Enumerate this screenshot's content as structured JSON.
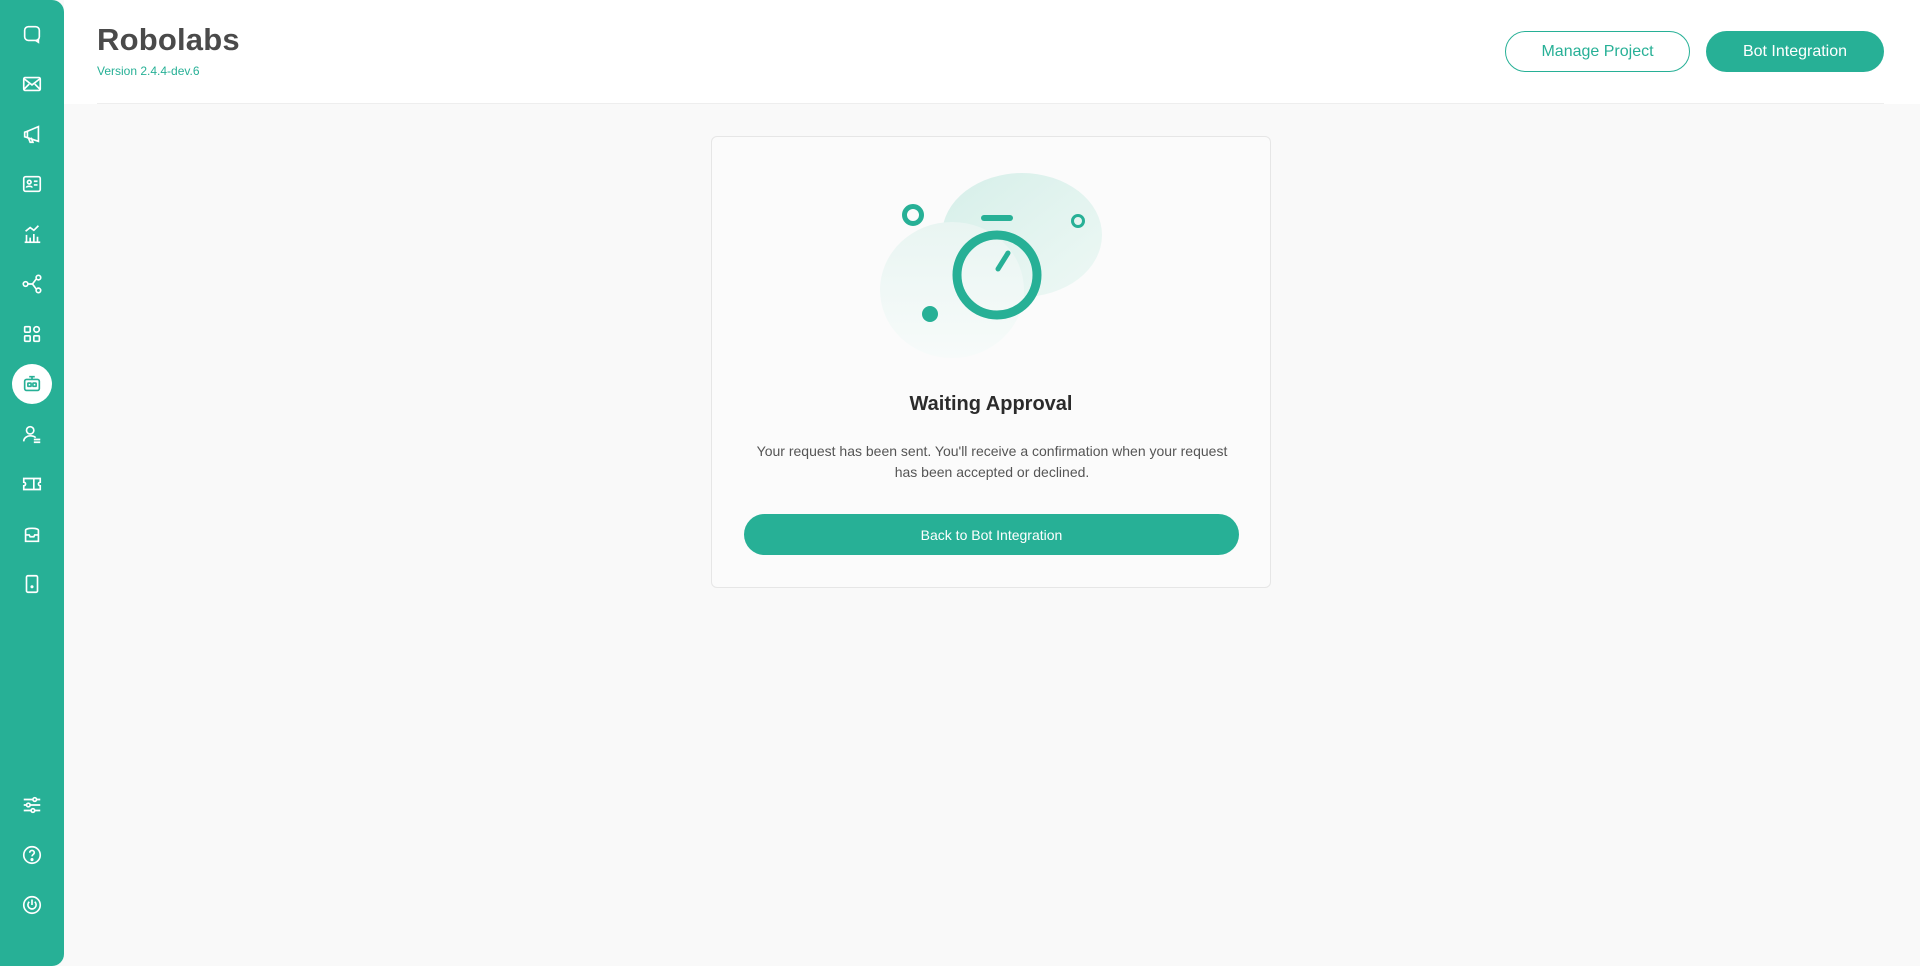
{
  "app": {
    "title": "Robolabs",
    "version": "Version 2.4.4-dev.6"
  },
  "header": {
    "manage_project_label": "Manage Project",
    "bot_integration_label": "Bot Integration"
  },
  "sidebar": {
    "top_items": [
      {
        "icon": "chat-icon",
        "active": false
      },
      {
        "icon": "mail-icon",
        "active": false
      },
      {
        "icon": "megaphone-icon",
        "active": false
      },
      {
        "icon": "contact-card-icon",
        "active": false
      },
      {
        "icon": "analytics-icon",
        "active": false
      },
      {
        "icon": "flow-icon",
        "active": false
      },
      {
        "icon": "apps-grid-icon",
        "active": false
      },
      {
        "icon": "bot-icon",
        "active": true
      },
      {
        "icon": "agent-icon",
        "active": false
      },
      {
        "icon": "ticket-icon",
        "active": false
      },
      {
        "icon": "inbox-icon",
        "active": false
      },
      {
        "icon": "device-icon",
        "active": false
      }
    ],
    "bottom_items": [
      {
        "icon": "settings-sliders-icon"
      },
      {
        "icon": "help-icon"
      },
      {
        "icon": "power-icon"
      }
    ]
  },
  "card": {
    "illustration": "stopwatch-icon",
    "title": "Waiting Approval",
    "description": "Your request has been sent. You'll receive a confirmation when your request has been accepted or declined.",
    "button_label": "Back to Bot Integration"
  },
  "colors": {
    "accent": "#27b096",
    "background": "#f9f9f9"
  }
}
